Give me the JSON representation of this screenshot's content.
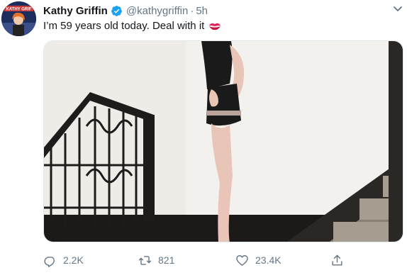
{
  "tweet": {
    "author_name": "Kathy Griffin",
    "handle": "@kathygriffin",
    "separator": "·",
    "time": "5h",
    "text": "I’m 59 years old today. Deal with it",
    "avatar_caption": "KATHY GRIF"
  },
  "actions": {
    "replies": "2.2K",
    "retweets": "821",
    "likes": "23.4K"
  },
  "icons": {
    "verified": "verified-badge-icon",
    "caret": "chevron-down-icon",
    "emoji": "kiss-mark-emoji",
    "reply": "reply-icon",
    "retweet": "retweet-icon",
    "like": "heart-icon",
    "share": "share-icon"
  },
  "colors": {
    "verified_blue": "#1da1f2",
    "muted_text": "#657786",
    "lips_red": "#e0245e"
  }
}
